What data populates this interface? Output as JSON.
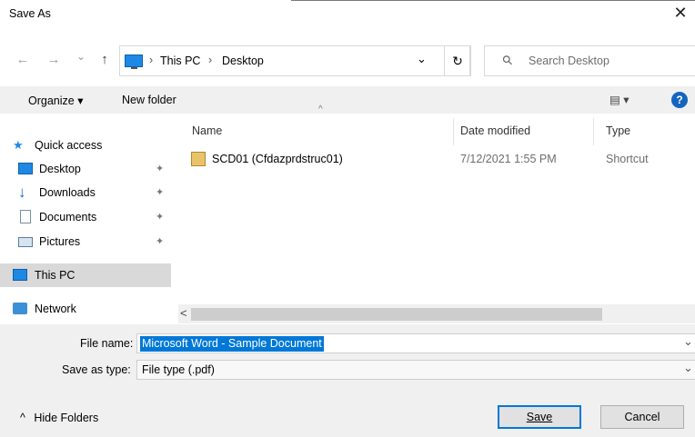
{
  "window": {
    "title": "Save As",
    "close_symbol": "✕"
  },
  "nav": {
    "back_symbol": "←",
    "forward_symbol": "→",
    "history_symbol": "⌄",
    "up_symbol": "↑",
    "refresh_symbol": "↻"
  },
  "breadcrumb": {
    "sep": "›",
    "items": [
      "This PC",
      "Desktop"
    ],
    "dropdown_symbol": "⌄"
  },
  "search": {
    "placeholder": "Search Desktop"
  },
  "toolbar": {
    "organize_label": "Organize ▾",
    "new_folder_label": "New folder",
    "view_symbol": "▤ ▾",
    "help_symbol": "?"
  },
  "sidebar": {
    "quick_access": "Quick access",
    "items": [
      "Desktop",
      "Downloads",
      "Documents",
      "Pictures"
    ],
    "pin_symbol": "📌",
    "this_pc": "This PC",
    "network": "Network"
  },
  "columns": {
    "name": "Name",
    "date": "Date modified",
    "type": "Type",
    "sort_symbol": "^"
  },
  "files": [
    {
      "name": "SCD01 (Cfdazprdstruc01)",
      "date": "7/12/2021 1:55 PM",
      "type": "Shortcut"
    }
  ],
  "scroll": {
    "left_symbol": "<"
  },
  "form": {
    "file_name_label": "File name:",
    "file_name_value": "Microsoft Word - Sample Document",
    "save_type_label": "Save as type:",
    "save_type_value": "File type (.pdf)",
    "dropdown_symbol": "⌄"
  },
  "footer": {
    "hide_folders": "Hide Folders",
    "hide_symbol": "^",
    "save_label": "Save",
    "cancel_label": "Cancel"
  },
  "colors": {
    "accent": "#1e88e5",
    "selection": "#0078d7",
    "selected_row": "#cce8ff",
    "help": "#1565c0"
  }
}
